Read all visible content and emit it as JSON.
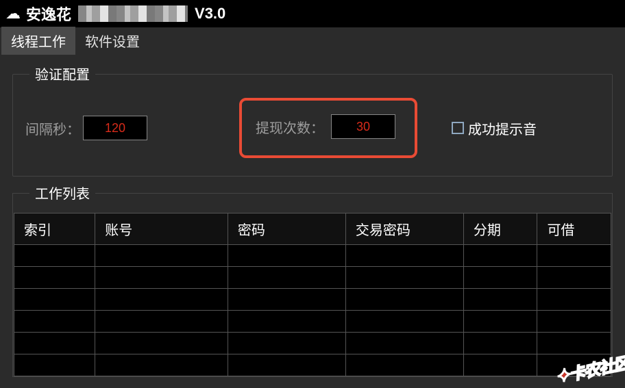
{
  "title": {
    "prefix": "安逸花",
    "version": "V3.0"
  },
  "tabs": [
    {
      "label": "线程工作",
      "active": true
    },
    {
      "label": "软件设置",
      "active": false
    }
  ],
  "verifyGroup": {
    "title": "验证配置",
    "intervalLabel": "间隔秒：",
    "intervalValue": "120",
    "withdrawLabel": "提现次数：",
    "withdrawValue": "30",
    "soundLabel": "成功提示音"
  },
  "workGroup": {
    "title": "工作列表",
    "columns": [
      "索引",
      "账号",
      "密码",
      "交易密码",
      "分期",
      "可借"
    ]
  },
  "watermark": "卡农社区"
}
